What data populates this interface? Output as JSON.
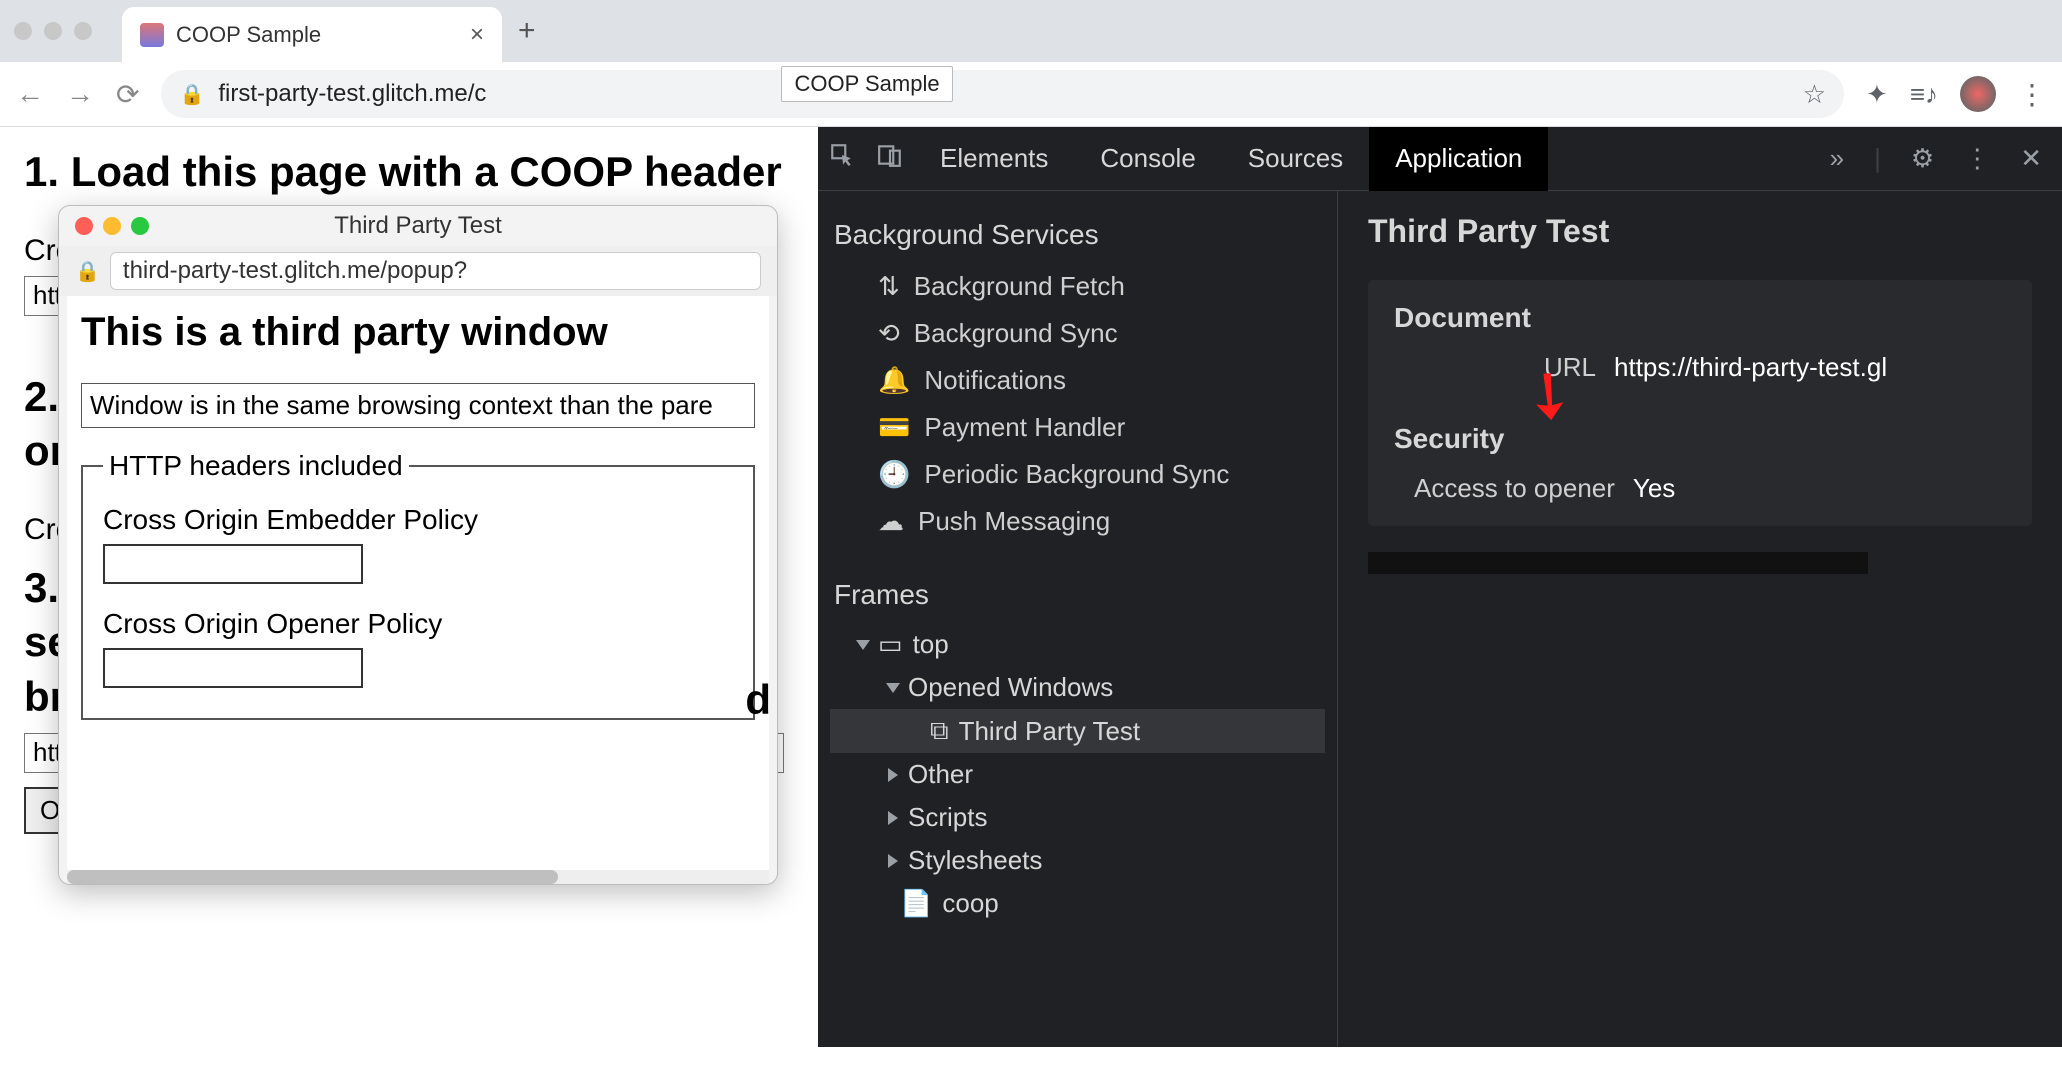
{
  "browser": {
    "tab_title": "COOP Sample",
    "address": "first-party-test.glitch.me/c",
    "address_tooltip": "COOP Sample"
  },
  "page": {
    "h1": "1. Load this page with a COOP header",
    "label1": "Cro",
    "input1": "http",
    "h2": "2.",
    "h2b": "or",
    "label2": "Cro",
    "h3": "3.",
    "h3b": "se",
    "h3c": "br",
    "url_input": "https://third-party-test.glitch.me/popup?",
    "open_btn": "Open a popup"
  },
  "popup": {
    "title": "Third Party Test",
    "url": "third-party-test.glitch.me/popup?",
    "h1": "This is a third party window",
    "status": "Window is in the same browsing context than the pare",
    "legend": "HTTP headers included",
    "coep_label": "Cross Origin Embedder Policy",
    "coop_label": "Cross Origin Opener Policy",
    "h3_partial": "d"
  },
  "devtools": {
    "tabs": [
      "Elements",
      "Console",
      "Sources",
      "Application"
    ],
    "active_tab": "Application",
    "sidebar": {
      "section1": "Background Services",
      "items1": [
        "Background Fetch",
        "Background Sync",
        "Notifications",
        "Payment Handler",
        "Periodic Background Sync",
        "Push Messaging"
      ],
      "section2": "Frames",
      "frames_top": "top",
      "opened_windows": "Opened Windows",
      "selected_frame": "Third Party Test",
      "other": "Other",
      "scripts": "Scripts",
      "stylesheets": "Stylesheets",
      "coop": "coop"
    },
    "main": {
      "title": "Third Party Test",
      "section_document": "Document",
      "url_label": "URL",
      "url_value": "https://third-party-test.gl",
      "section_security": "Security",
      "access_label": "Access to opener",
      "access_value": "Yes"
    }
  }
}
